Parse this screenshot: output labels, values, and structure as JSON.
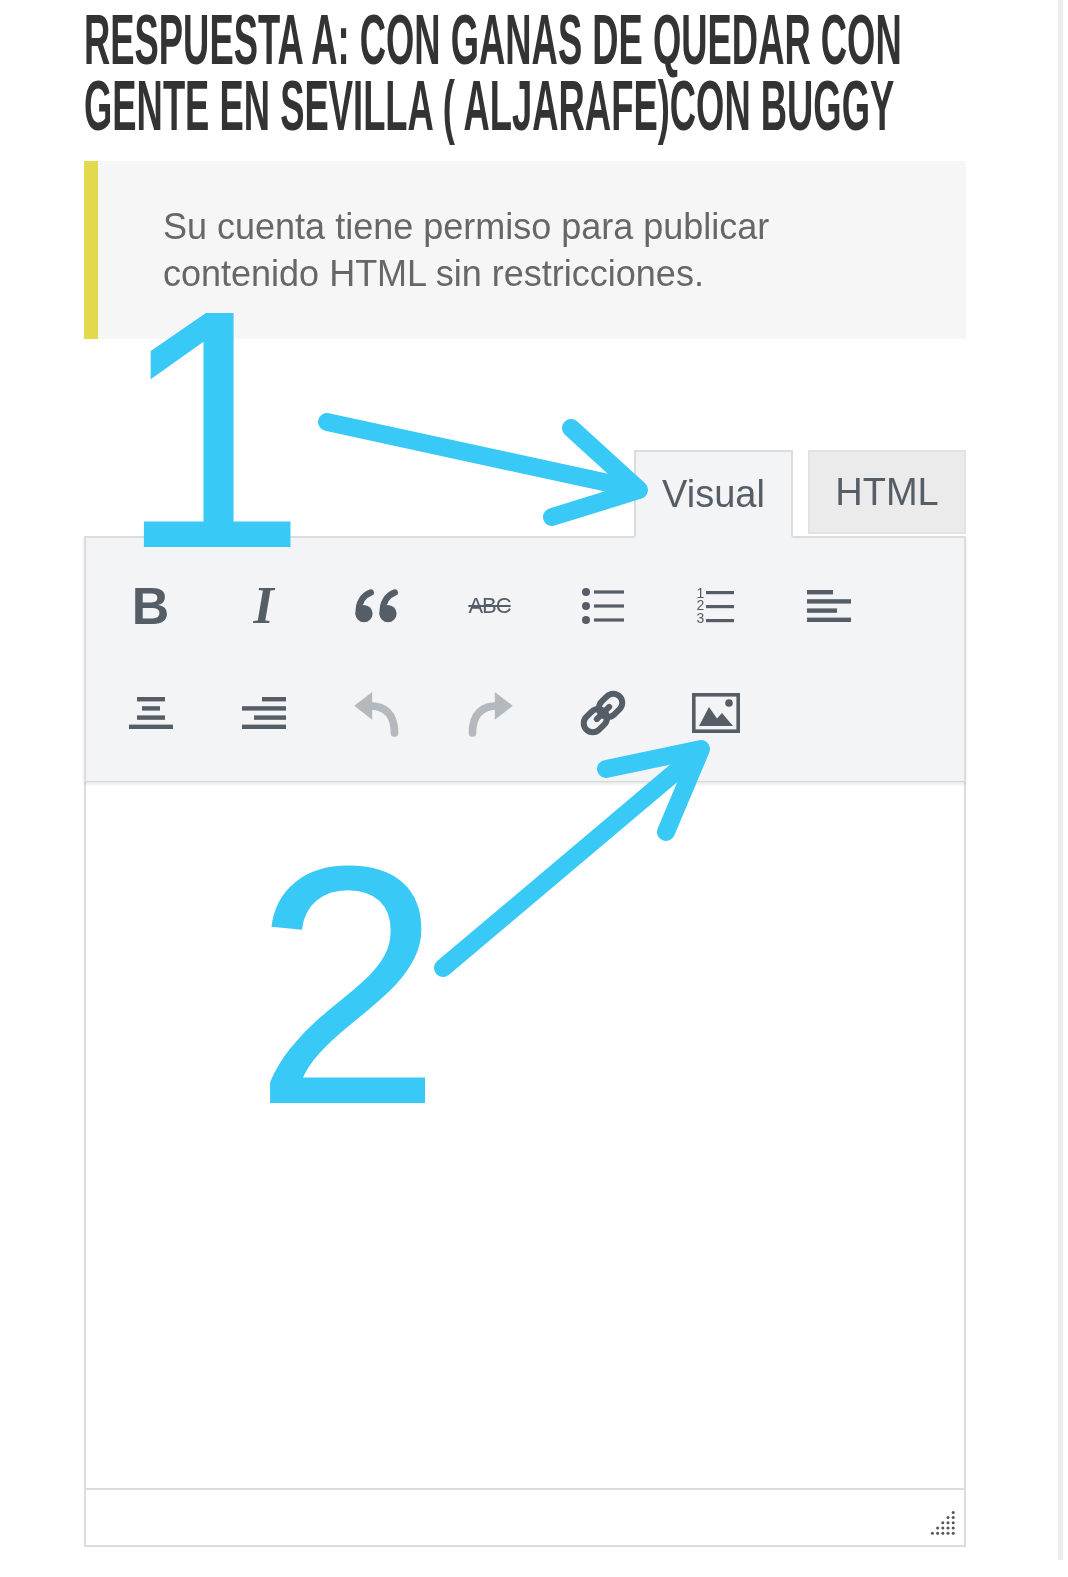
{
  "page_title": "RESPUESTA A: CON GANAS DE QUEDAR CON GENTE EN SEVILLA ( ALJARAFE)CON BUGGY",
  "notice": {
    "text": "Su cuenta tiene permiso para publicar contenido HTML sin restricciones."
  },
  "editor": {
    "tabs": [
      {
        "label": "Visual",
        "selected": true
      },
      {
        "label": "HTML",
        "selected": false
      }
    ],
    "toolbar": [
      {
        "kind": "bold",
        "glyph": "B",
        "disabled": false
      },
      {
        "kind": "italic",
        "glyph": "I",
        "disabled": false
      },
      {
        "kind": "quote",
        "disabled": false
      },
      {
        "kind": "strikethrough",
        "glyph": "ABC",
        "disabled": false
      },
      {
        "kind": "bullet-list",
        "disabled": false
      },
      {
        "kind": "numbered-list",
        "digits": [
          "1",
          "2",
          "3"
        ],
        "disabled": false
      },
      {
        "kind": "align-left",
        "disabled": false
      },
      {
        "kind": "align-center",
        "disabled": false
      },
      {
        "kind": "align-right",
        "disabled": false
      },
      {
        "kind": "undo",
        "disabled": true
      },
      {
        "kind": "redo",
        "disabled": true
      },
      {
        "kind": "link",
        "disabled": false
      },
      {
        "kind": "image",
        "disabled": false
      }
    ]
  },
  "annotations": [
    {
      "label": "1"
    },
    {
      "label": "2"
    }
  ]
}
